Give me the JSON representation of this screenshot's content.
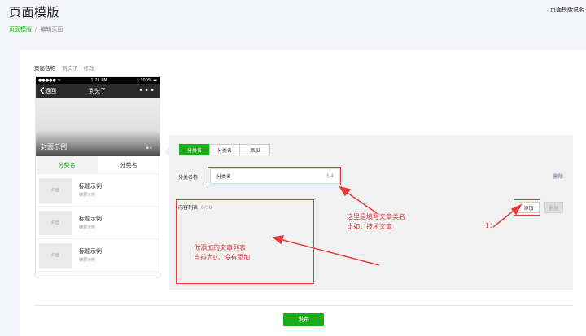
{
  "header": {
    "title": "页面模版",
    "top_right": "页面模版说明"
  },
  "breadcrumb": {
    "parent": "页面模版",
    "separator": "/",
    "current": "编辑页面"
  },
  "page_name": {
    "label": "页面名称",
    "value": "到头了",
    "edit": "修改"
  },
  "phone": {
    "status": {
      "signal": "●●●●● ᯤ",
      "time": "1:21 PM",
      "battery": "∦ 100% ▬"
    },
    "nav": {
      "back": "返回",
      "title": "到头了",
      "menu": "•••"
    },
    "cover_title": "封面示例",
    "cover_arrow": "▪ ▸",
    "tabs": [
      {
        "label": "分类名",
        "active": true
      },
      {
        "label": "分类名",
        "active": false
      }
    ],
    "articles": [
      {
        "thumb": "封面",
        "title": "标题示例",
        "subtitle": "摘要示例"
      },
      {
        "thumb": "封面",
        "title": "标题示例",
        "subtitle": "摘要示例"
      },
      {
        "thumb": "封面",
        "title": "标题示例",
        "subtitle": "摘要示例"
      }
    ]
  },
  "editor": {
    "tabs": [
      {
        "label": "分类名",
        "active": true
      },
      {
        "label": "分类名",
        "active": false
      },
      {
        "label": "添加",
        "active": false
      }
    ],
    "category_label": "分类名称",
    "category_value": "分类名",
    "category_count": "3/4",
    "delete": "删除",
    "list_label": "内容列表",
    "list_count": "0/30",
    "add": "添加",
    "remove": "删除"
  },
  "annotations": {
    "category_note": [
      "这里是填写文章类名",
      "比如：技术文章"
    ],
    "list_note": [
      "你添加的文章列表",
      "当前为0，没有添加"
    ],
    "add_note": "1："
  },
  "footer": {
    "publish": "发布"
  },
  "colors": {
    "accent": "#1aad19",
    "annotation": "#e83a3a"
  }
}
